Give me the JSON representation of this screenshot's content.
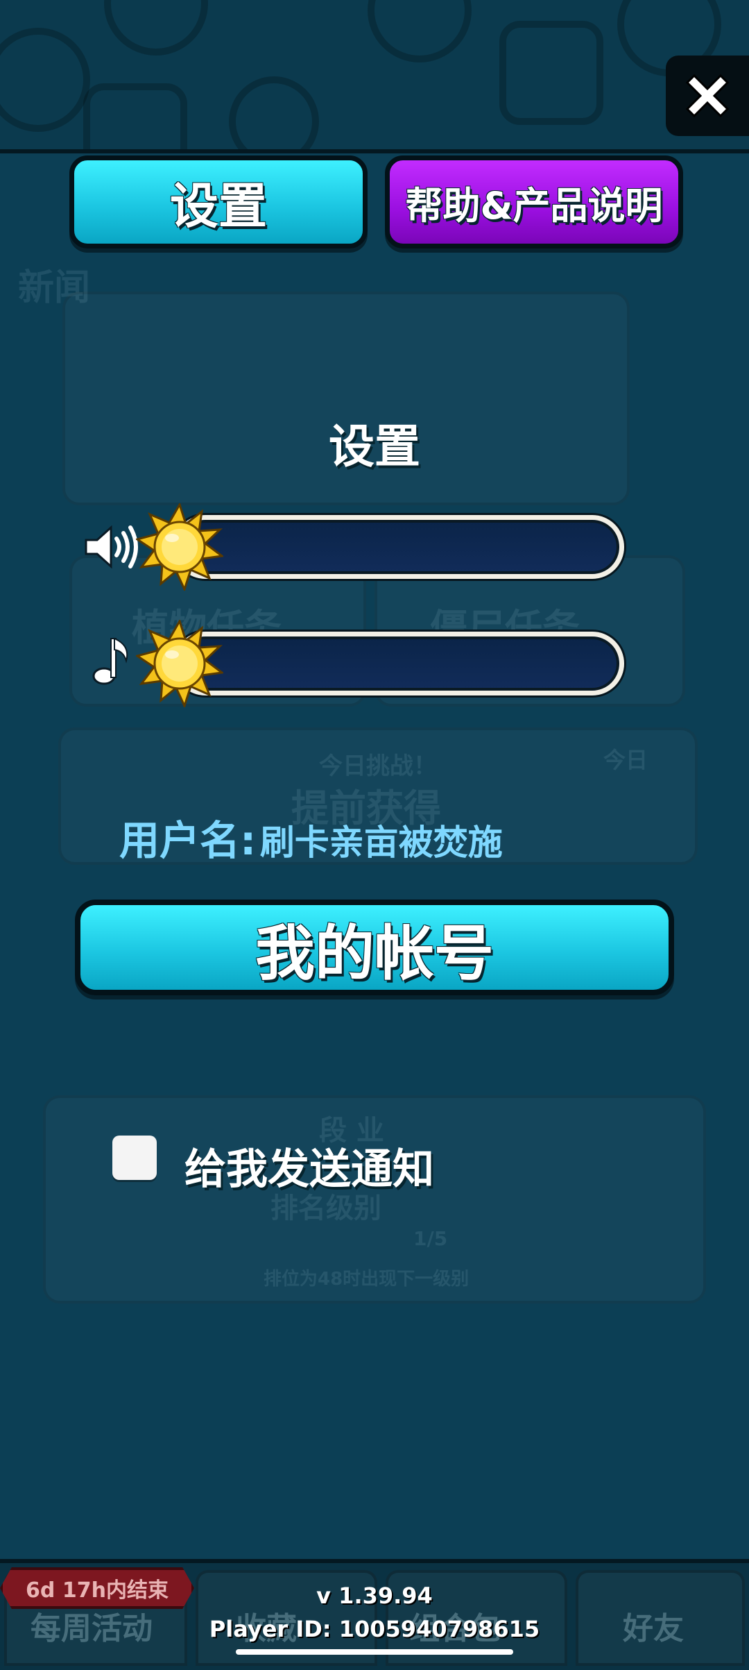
{
  "header": {
    "settings_tab_label": "设置",
    "help_tab_label": "帮助&产品说明"
  },
  "settings": {
    "title": "设置",
    "sound_volume": 0,
    "music_volume": 0,
    "username_label": "用户名:",
    "username_value": "刷卡亲亩被焚施",
    "account_button_label": "我的帐号",
    "notifications_label": "给我发送通知",
    "notifications_checked": false
  },
  "background": {
    "news_label": "新闻",
    "plant_quests_label": "植物任务",
    "zombie_quests_label": "僵尸任务",
    "daily_label": "今日挑战！",
    "daily_sub": "提前获得",
    "today_label": "今日",
    "rank_label": "段 业",
    "rank_sub": "排名级别",
    "progress": "1/5",
    "rank_hint": "排位为48时出现下一级别",
    "event_timer": "6d 17h内结束",
    "bottom_tabs": [
      "每周活动",
      "收藏",
      "组合包",
      "好友"
    ]
  },
  "footer": {
    "version": "v 1.39.94",
    "player_id": "Player ID: 1005940798615"
  },
  "colors": {
    "cyan_button": "#1cc7e2",
    "purple_button": "#9a0fe0",
    "username_color": "#7fd8ff",
    "track_color": "#122c5a"
  }
}
